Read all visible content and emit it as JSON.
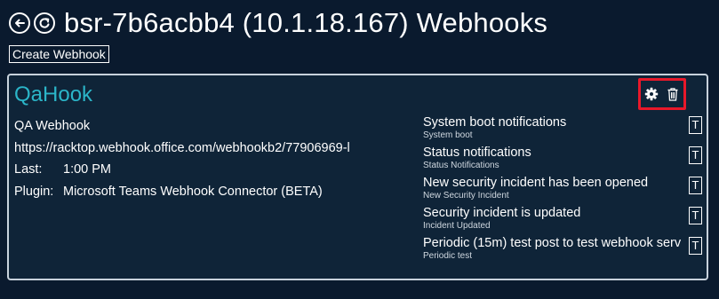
{
  "header": {
    "back_icon": "back-arrow-icon",
    "refresh_icon": "refresh-icon",
    "title": "bsr-7b6acbb4 (10.1.18.167) Webhooks"
  },
  "toolbar": {
    "create_label": "Create Webhook"
  },
  "webhook": {
    "name": "QaHook",
    "description": "QA Webhook",
    "url": "https://racktop.webhook.office.com/webhookb2/77906969-l",
    "last_label": "Last:",
    "last_value": "1:00 PM",
    "plugin_label": "Plugin:",
    "plugin_value": "Microsoft Teams Webhook Connector (BETA)",
    "actions": {
      "settings_icon": "gear-icon",
      "delete_icon": "trash-icon",
      "highlight_color": "#e8182a"
    },
    "notifications": [
      {
        "title": "System boot notifications",
        "subtitle": "System boot",
        "button": "T"
      },
      {
        "title": "Status notifications",
        "subtitle": "Status Notifications",
        "button": "T"
      },
      {
        "title": "New security incident has been opened",
        "subtitle": "New Security Incident",
        "button": "T"
      },
      {
        "title": "Security incident is updated",
        "subtitle": "Incident Updated",
        "button": "T"
      },
      {
        "title": "Periodic (15m) test post to test webhook serv",
        "subtitle": "Periodic test",
        "button": "T"
      }
    ]
  },
  "colors": {
    "background": "#0a1a2e",
    "card": "#0f2438",
    "accent": "#2bb5c8"
  }
}
